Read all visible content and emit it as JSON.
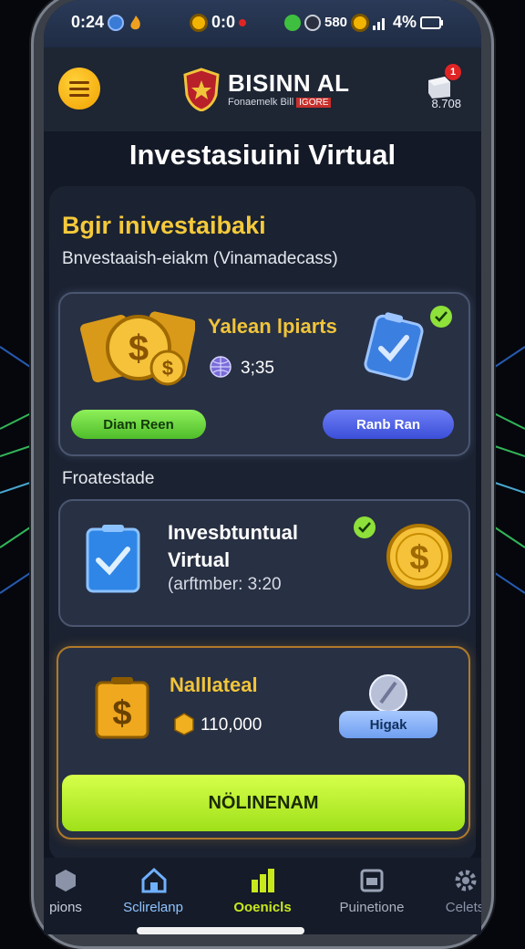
{
  "status_bar": {
    "time": "0:24",
    "center_text": "0:0",
    "right_number": "580",
    "battery": "4%"
  },
  "header": {
    "brand_title": "BISINN AL",
    "brand_subtitle": "Fonaemelk Bill",
    "brand_tag": "IGORE",
    "cart_count": "8.708",
    "cart_badge": "1"
  },
  "page_title": "Investasiuini Virtual",
  "main": {
    "section_title": "Bgir inivestaibaki",
    "section_subtitle": "Bnvestaaish-eiakm (Vinamadecass)",
    "card1": {
      "title": "Yalean lpiarts",
      "value": "3;35",
      "left_button": "Diam Reen",
      "right_button": "Ranb Ran"
    },
    "mid_label": "Froatestade",
    "card2": {
      "title_line1": "Invesbtuntual",
      "title_line2": "Virtual",
      "subtitle": "(arftmber: 3:20"
    },
    "card3": {
      "title": "Nalllateal",
      "value": "110,000",
      "button": "Higak",
      "action_button": "NÖLINENAM"
    }
  },
  "bottom_nav": [
    {
      "label": "pions"
    },
    {
      "label": "Sclirelanp"
    },
    {
      "label": "Ooenicls"
    },
    {
      "label": "Puinetione"
    },
    {
      "label": "Celets"
    }
  ],
  "colors": {
    "accent_gold": "#f0c43b",
    "accent_green": "#a6e81e",
    "accent_blue": "#3b4fd8",
    "nav_active_green": "#c8e81e"
  }
}
